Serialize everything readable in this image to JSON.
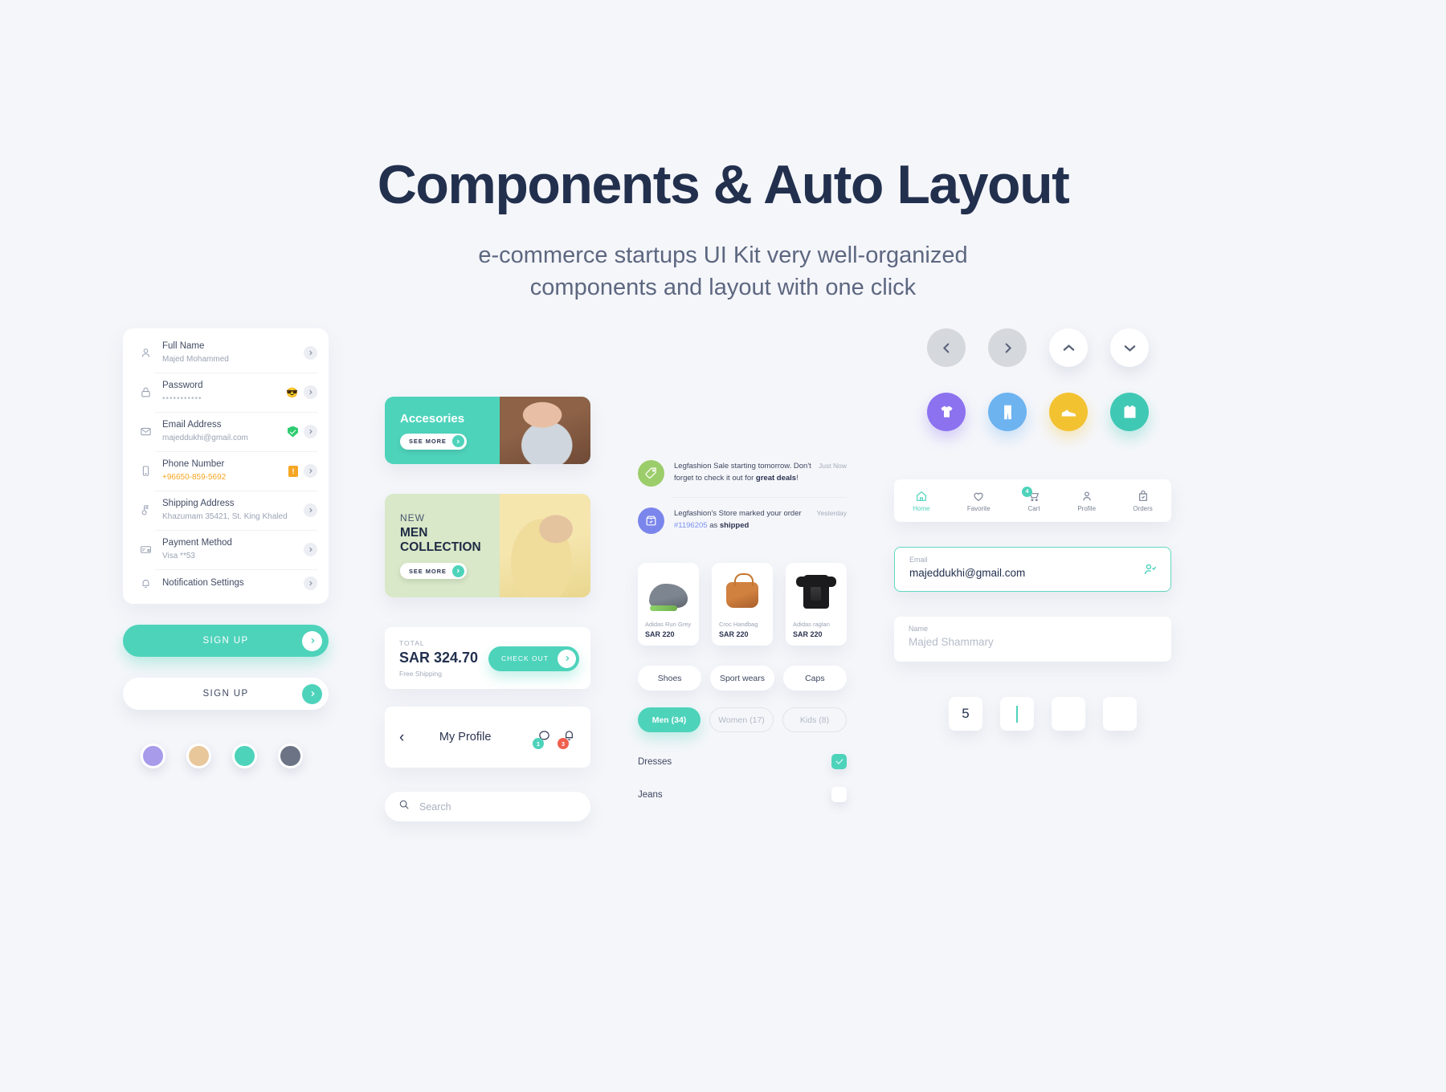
{
  "hero": {
    "title": "Components & Auto Layout",
    "subtitle_line1": "e-commerce startups UI Kit very well-organized",
    "subtitle_line2": "components and layout with one click"
  },
  "colors": {
    "accent_teal": "#4ed3bb",
    "dark_navy": "#22304e",
    "muted_grey": "#9aa3b4",
    "warning_orange": "#f5a623",
    "success_green": "#2ecc71",
    "danger_red": "#f0604d"
  },
  "profile_list": {
    "rows": [
      {
        "icon": "person-icon",
        "label": "Full Name",
        "value": "Majed Mohammed"
      },
      {
        "icon": "lock-icon",
        "label": "Password",
        "value": "•••••••••••"
      },
      {
        "icon": "mail-icon",
        "label": "Email Address",
        "value": "majeddukhi@gmail.com"
      },
      {
        "icon": "phone-icon",
        "label": "Phone Number",
        "value": "+96650-859-5692"
      },
      {
        "icon": "map-pin-icon",
        "label": "Shipping Address",
        "value": "Khazumam 35421, St. King Khaled"
      },
      {
        "icon": "card-icon",
        "label": "Payment Method",
        "value": "Visa **53"
      },
      {
        "icon": "bell-icon",
        "label": "Notification Settings",
        "value": ""
      }
    ]
  },
  "buttons": {
    "signup_primary": "SIGN UP",
    "signup_secondary": "SIGN UP"
  },
  "swatches": [
    {
      "name": "swatch-lavender",
      "hex": "#a79bea"
    },
    {
      "name": "swatch-tan",
      "hex": "#e8c79b"
    },
    {
      "name": "swatch-teal",
      "hex": "#4ed3bb"
    },
    {
      "name": "swatch-slate",
      "hex": "#6b7385"
    }
  ],
  "banners": [
    {
      "title": "Accesories",
      "kicker": "",
      "cta": "SEE MORE"
    },
    {
      "title": "MEN COLLECTION",
      "kicker": "NEW",
      "cta": "SEE MORE"
    }
  ],
  "total_card": {
    "kicker": "TOTAL",
    "amount": "SAR 324.70",
    "shipping": "Free Shipping",
    "cta": "CHECK OUT"
  },
  "profile_bar": {
    "title": "My Profile",
    "chat_badge": "1",
    "bell_badge": "3"
  },
  "search": {
    "placeholder": "Search"
  },
  "notifications": [
    {
      "icon": "tag-icon",
      "text_plain_1": "Legfashion Sale starting tomorrow. Don't forget to check it out for ",
      "text_bold": "great deals",
      "text_plain_2": "!",
      "time": "Just Now"
    },
    {
      "icon": "package-icon",
      "text_plain_1": "Legfashion's Store marked your order ",
      "order_no": "#1196205",
      "text_plain_2": " as ",
      "text_bold": "shipped",
      "time": "Yesterday"
    }
  ],
  "products": [
    {
      "name": "Adidas Run Grey",
      "price": "SAR 220",
      "image": "grey-sneaker"
    },
    {
      "name": "Croc Handbag",
      "price": "SAR 220",
      "image": "brown-handbag"
    },
    {
      "name": "Adidas raglan",
      "price": "SAR 220",
      "image": "black-tshirt"
    }
  ],
  "filter_chips": [
    "Shoes",
    "Sport wears",
    "Caps"
  ],
  "segment_chips": [
    {
      "label": "Men (34)",
      "selected": true
    },
    {
      "label": "Women (17)",
      "selected": false
    },
    {
      "label": "Kids (8)",
      "selected": false
    }
  ],
  "checkboxes": [
    {
      "label": "Dresses",
      "checked": true
    },
    {
      "label": "Jeans",
      "checked": false
    }
  ],
  "round_buttons": [
    {
      "name": "chevron-left-button",
      "style": "grey"
    },
    {
      "name": "chevron-right-button",
      "style": "grey"
    },
    {
      "name": "chevron-up-button",
      "style": "white"
    },
    {
      "name": "chevron-down-button",
      "style": "white"
    }
  ],
  "category_icons": [
    {
      "name": "tshirt-icon",
      "color": "#8c72ef"
    },
    {
      "name": "pants-icon",
      "color": "#6cb3f0"
    },
    {
      "name": "shoe-icon",
      "color": "#f2c231"
    },
    {
      "name": "jacket-icon",
      "color": "#3fc9b4"
    }
  ],
  "bottom_nav": [
    {
      "label": "Home",
      "icon": "home-icon",
      "active": true,
      "badge": ""
    },
    {
      "label": "Favorite",
      "icon": "heart-icon",
      "active": false,
      "badge": ""
    },
    {
      "label": "Cart",
      "icon": "cart-icon",
      "active": false,
      "badge": "4"
    },
    {
      "label": "Profile",
      "icon": "person-icon",
      "active": false,
      "badge": ""
    },
    {
      "label": "Orders",
      "icon": "bag-check-icon",
      "active": false,
      "badge": ""
    }
  ],
  "fields": {
    "email": {
      "label": "Email",
      "value": "majeddukhi@gmail.com",
      "focused": true
    },
    "name": {
      "label": "Name",
      "placeholder": "Majed Shammary",
      "focused": false
    }
  },
  "otp": [
    "5",
    "",
    "",
    ""
  ]
}
